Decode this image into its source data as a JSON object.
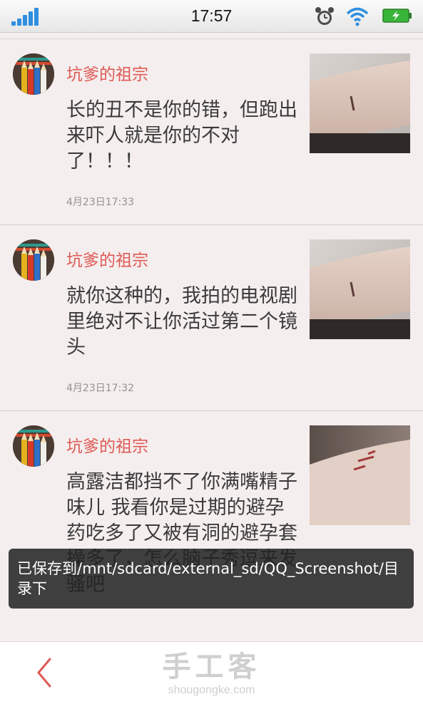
{
  "status_bar": {
    "time": "17:57",
    "icons": [
      "signal-icon",
      "alarm-clock-icon",
      "wifi-icon",
      "battery-charging-icon"
    ],
    "signal_color": "#2f8fe0",
    "battery_color": "#39b53a"
  },
  "posts": [
    {
      "user_name": "坑爹的祖宗",
      "text": "长的丑不是你的错，但跑出来吓人就是你的不对了！！！",
      "time": "4月23日17:33"
    },
    {
      "user_name": "坑爹的祖宗",
      "text": "就你这种的，我拍的电视剧里绝对不让你活过第二个镜头",
      "time": "4月23日17:32"
    },
    {
      "user_name": "坑爹的祖宗",
      "text": "高露洁都挡不了你满嘴精子味儿 我看你是过期的避孕药吃多了又被有洞的避孕套操多了，怎么脑子秀逗来发骚吧",
      "time": ""
    }
  ],
  "toast": {
    "message": "已保存到/mnt/sdcard/external_sd/QQ_Screenshot/目录下"
  },
  "bottom_bar": {
    "back_icon": "chevron-left-icon",
    "watermark_cn": "手工客",
    "watermark_en": "shougongke.com"
  },
  "colors": {
    "accent": "#de5a55",
    "background": "#f5eeee",
    "text": "#3a3a3a"
  }
}
